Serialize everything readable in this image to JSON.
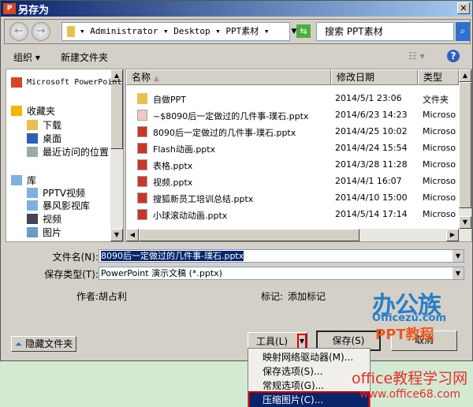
{
  "title": "另存为",
  "address": {
    "path": "▾ Administrator ▾ Desktop ▾ PPT素材 ▾",
    "search_placeholder": "搜索 PPT素材"
  },
  "toolbar": {
    "organize": "组织 ▾",
    "new_folder": "新建文件夹"
  },
  "nav": {
    "items": [
      {
        "label": "Microsoft PowerPoint",
        "icon": "powerpoint-icon"
      },
      {
        "label": "收藏夹",
        "icon": "star-icon"
      },
      {
        "label": "下载",
        "icon": "download-folder-icon"
      },
      {
        "label": "桌面",
        "icon": "desktop-icon"
      },
      {
        "label": "最近访问的位置",
        "icon": "recent-places-icon"
      },
      {
        "label": "库",
        "icon": "library-icon"
      },
      {
        "label": "PPTV视频",
        "icon": "library-icon"
      },
      {
        "label": "暴风影视库",
        "icon": "library-icon"
      },
      {
        "label": "视频",
        "icon": "video-icon"
      },
      {
        "label": "图片",
        "icon": "pictures-icon"
      }
    ]
  },
  "columns": {
    "name": "名称",
    "date": "修改日期",
    "type": "类型"
  },
  "files": [
    {
      "name": "自做PPT",
      "date": "2014/5/1 23:06",
      "type": "文件夹",
      "kind": "folder"
    },
    {
      "name": "~$8090后一定做过的几件事-璞石.pptx",
      "date": "2014/6/23 14:23",
      "type": "Microso",
      "kind": "temp"
    },
    {
      "name": "8090后一定做过的几件事-璞石.pptx",
      "date": "2014/4/25 10:02",
      "type": "Microso",
      "kind": "pptx"
    },
    {
      "name": "Flash动画.pptx",
      "date": "2014/4/24 15:54",
      "type": "Microso",
      "kind": "pptx"
    },
    {
      "name": "表格.pptx",
      "date": "2014/3/28 11:28",
      "type": "Microso",
      "kind": "pptx"
    },
    {
      "name": "视频.pptx",
      "date": "2014/4/1 16:07",
      "type": "Microso",
      "kind": "pptx"
    },
    {
      "name": "搜狐新员工培训总结.pptx",
      "date": "2014/4/10 15:00",
      "type": "Microso",
      "kind": "pptx"
    },
    {
      "name": "小球滚动动画.pptx",
      "date": "2014/5/14 17:14",
      "type": "Microso",
      "kind": "pptx"
    }
  ],
  "form": {
    "filename_label": "文件名(N):",
    "filename": "8090后一定做过的几件事-璞石.pptx",
    "type_label": "保存类型(T):",
    "type": "PowerPoint 演示文稿 (*.pptx)",
    "author_label": "作者:",
    "author": "胡占利",
    "tags_label": "标记:",
    "tags": "添加标记"
  },
  "buttons": {
    "hide_folders": "隐藏文件夹",
    "tools": "工具(L)",
    "save": "保存(S)",
    "cancel": "取消"
  },
  "menu": [
    "映射网络驱动器(M)...",
    "保存选项(S)...",
    "常规选项(G)...",
    "压缩图片(C)..."
  ],
  "watermark": {
    "logo": "办公族",
    "logo_sub": "Officezu.com",
    "logo_tag": "PPT教程",
    "site": "office教程学习网",
    "url": "www.office68.com"
  }
}
